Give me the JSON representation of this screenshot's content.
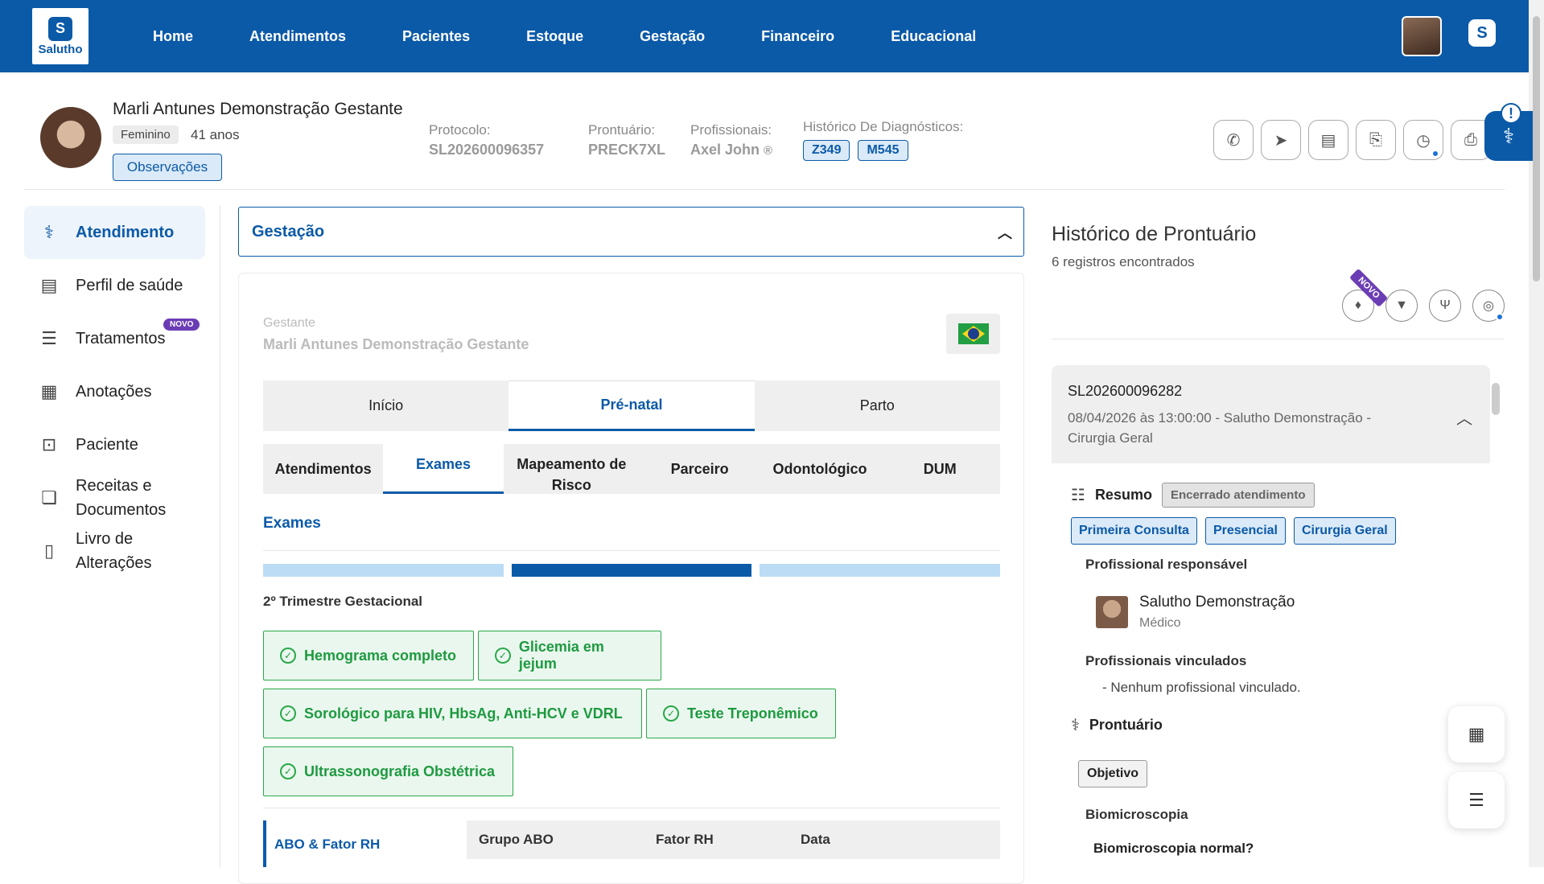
{
  "brand": {
    "logo_text": "Salutho",
    "logo_mark": "S"
  },
  "nav": [
    "Home",
    "Atendimentos",
    "Pacientes",
    "Estoque",
    "Gestação",
    "Financeiro",
    "Educacional"
  ],
  "patient": {
    "name": "Marli Antunes Demonstração Gestante",
    "gender": "Feminino",
    "age": "41 anos",
    "observations_button": "Observações",
    "protocol_label": "Protocolo:",
    "protocol_value": "SL202600096357",
    "record_label": "Prontuário:",
    "record_value": "PRECK7XL",
    "professionals_label": "Profissionais:",
    "professionals_value": "Axel John",
    "diagnoses_label": "Histórico De Diagnósticos:",
    "diagnoses": [
      "Z349",
      "M545"
    ]
  },
  "toolbar_icons": [
    "phone-icon",
    "send-icon",
    "document-icon",
    "clipboard-icon",
    "history-icon",
    "printer-icon"
  ],
  "alert_mark": "!",
  "sidebar": {
    "items": [
      {
        "label": "Atendimento",
        "icon": "stethoscope-icon",
        "active": true
      },
      {
        "label": "Perfil de saúde",
        "icon": "health-profile-icon"
      },
      {
        "label": "Tratamentos",
        "icon": "treatment-icon",
        "badge": "NOVO"
      },
      {
        "label": "Anotações",
        "icon": "notes-icon"
      },
      {
        "label": "Paciente",
        "icon": "patient-card-icon"
      },
      {
        "label": "Receitas e Documentos",
        "icon": "prescriptions-icon"
      },
      {
        "label": "Livro de Alterações",
        "icon": "book-icon"
      }
    ]
  },
  "main": {
    "section_title": "Gestação",
    "gestante_label": "Gestante",
    "gestante_value": "Marli Antunes Demonstração Gestante",
    "tabs": [
      "Início",
      "Pré-natal",
      "Parto"
    ],
    "active_tab": "Pré-natal",
    "subtabs": [
      "Atendimentos",
      "Exames",
      "Mapeamento de Risco",
      "Parceiro",
      "Odontológico",
      "DUM"
    ],
    "active_subtab": "Exames",
    "exams_title": "Exames",
    "progress_step": 2,
    "progress_total": 3,
    "trimester_label": "2º Trimestre Gestacional",
    "exams": [
      "Hemograma completo",
      "Glicemia em jejum",
      "Sorológico para HIV, HbsAg, Anti-HCV e VDRL",
      "Teste Treponêmico",
      "Ultrassonografia Obstétrica"
    ],
    "abo_label": "ABO & Fator RH",
    "abo_columns": [
      "Grupo ABO",
      "Fator RH",
      "Data"
    ]
  },
  "history": {
    "title": "Histórico de Prontuário",
    "count": "6 registros encontrados",
    "novo_badge": "NOVO",
    "record": {
      "code": "SL202600096282",
      "subtitle": "08/04/2026 às 13:00:00 - Salutho Demonstração - Cirurgia Geral",
      "resumo_label": "Resumo",
      "status": "Encerrado atendimento",
      "tags": [
        "Primeira Consulta",
        "Presencial",
        "Cirurgia Geral"
      ],
      "responsible_label": "Profissional responsável",
      "responsible_name": "Salutho Demonstração",
      "responsible_role": "Médico",
      "linked_label": "Profissionais vinculados",
      "linked_none": "- Nenhum profissional vinculado.",
      "record_label": "Prontuário",
      "objective": "Objetivo",
      "biomicroscopia": "Biomicroscopia",
      "biomicroscopia_q": "Biomicroscopia normal?"
    }
  }
}
